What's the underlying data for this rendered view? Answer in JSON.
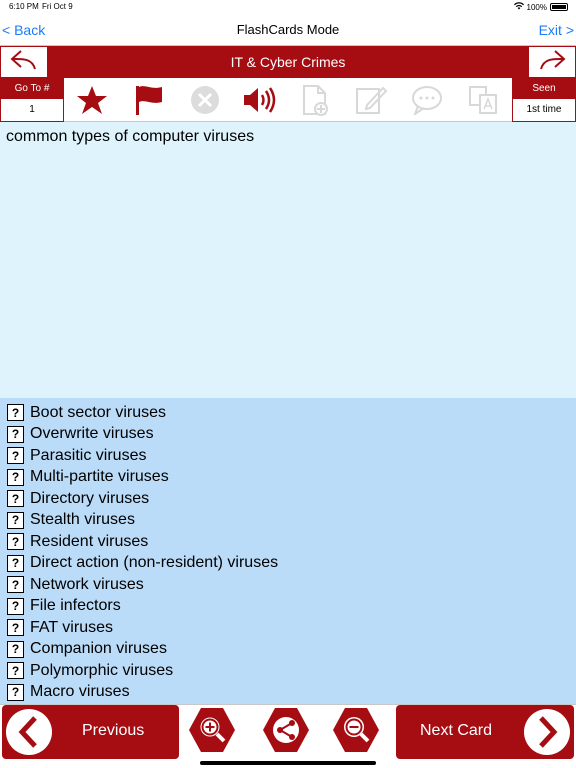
{
  "status": {
    "time": "6:10 PM",
    "date": "Fri Oct 9",
    "battery": "100%"
  },
  "nav": {
    "back": "< Back",
    "title": "FlashCards Mode",
    "exit": "Exit >"
  },
  "category": {
    "title": "IT & Cyber Crimes"
  },
  "toolbar": {
    "goto_label": "Go To #",
    "goto_value": "1",
    "seen_label": "Seen",
    "seen_value": "1st time",
    "icons": [
      "star-icon",
      "flag-icon",
      "delete-icon",
      "speaker-icon",
      "add-card-icon",
      "edit-icon",
      "comment-icon",
      "translate-icon"
    ]
  },
  "card": {
    "question": "common types of computer viruses",
    "answers": [
      "Boot sector viruses",
      "Overwrite viruses",
      "Parasitic viruses",
      "Multi-partite viruses",
      "Directory viruses",
      "Stealth viruses",
      "Resident viruses",
      "Direct action (non-resident) viruses",
      "Network viruses",
      "File infectors",
      "FAT viruses",
      "Companion viruses",
      "Polymorphic viruses",
      "Macro viruses"
    ],
    "answer_marker": "?"
  },
  "bottom": {
    "previous": "Previous",
    "next": "Next Card"
  },
  "colors": {
    "brand": "#a50d12",
    "question_bg": "#dff3fd",
    "answer_bg": "#bbdcf8",
    "link": "#1a7cf5"
  }
}
